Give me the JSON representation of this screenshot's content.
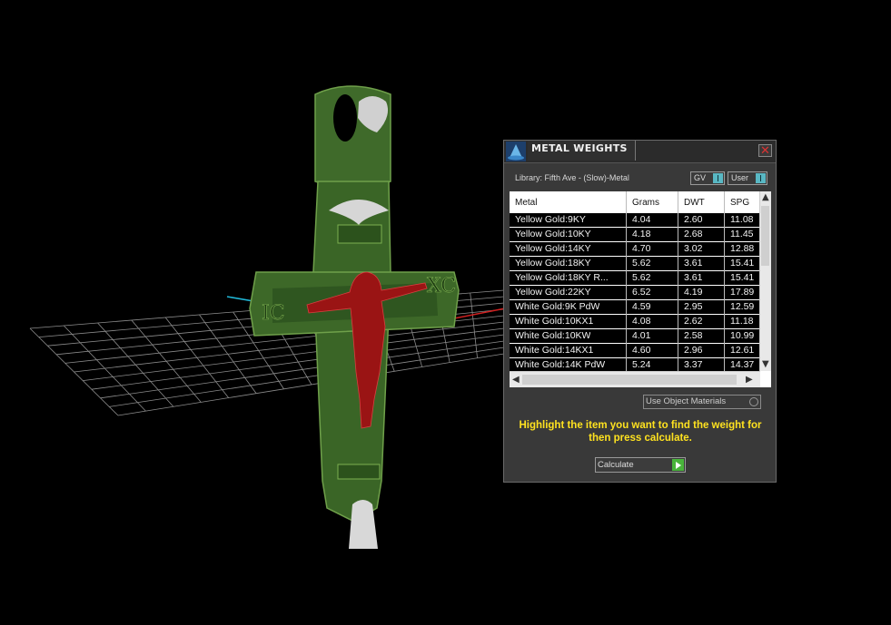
{
  "viewport": {
    "grid_color": "#9a9a9a",
    "axis_x_color": "#d02020",
    "axis_y_color": "#20b8d8",
    "model_color": "#3f6a2a",
    "figure_color": "#9a1414",
    "ornament_color": "#cfcfcf"
  },
  "panel": {
    "title": "METAL WEIGHTS",
    "logo_icon": "wizard-hat-icon",
    "close_icon": "close-icon",
    "library": "Library: Fifth Ave - (Slow)-Metal",
    "toggle_gv": "GV",
    "toggle_user": "User",
    "columns": [
      "Metal",
      "Grams",
      "DWT",
      "SPG"
    ],
    "rows": [
      [
        "Yellow Gold:9KY",
        "4.04",
        "2.60",
        "11.08"
      ],
      [
        "Yellow Gold:10KY",
        "4.18",
        "2.68",
        "11.45"
      ],
      [
        "Yellow Gold:14KY",
        "4.70",
        "3.02",
        "12.88"
      ],
      [
        "Yellow Gold:18KY",
        "5.62",
        "3.61",
        "15.41"
      ],
      [
        "Yellow Gold:18KY R...",
        "5.62",
        "3.61",
        "15.41"
      ],
      [
        "Yellow Gold:22KY",
        "6.52",
        "4.19",
        "17.89"
      ],
      [
        "White Gold:9K PdW",
        "4.59",
        "2.95",
        "12.59"
      ],
      [
        "White Gold:10KX1",
        "4.08",
        "2.62",
        "11.18"
      ],
      [
        "White Gold:10KW",
        "4.01",
        "2.58",
        "10.99"
      ],
      [
        "White Gold:14KX1",
        "4.60",
        "2.96",
        "12.61"
      ],
      [
        "White Gold:14K PdW",
        "5.24",
        "3.37",
        "14.37"
      ]
    ],
    "use_object_materials": "Use Object Materials",
    "hint": "Highlight the item you want to find the weight for then press calculate.",
    "calculate": "Calculate",
    "hint_color": "#ffe21f",
    "accent": "#59b8c4"
  }
}
